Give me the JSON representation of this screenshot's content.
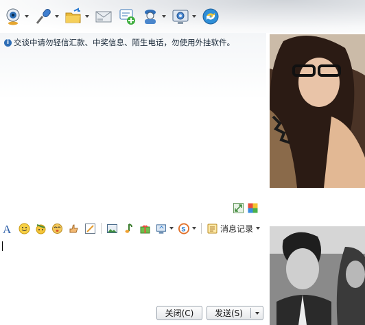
{
  "toolbar": {
    "items": [
      {
        "name": "video-call",
        "icon": "webcam-icon",
        "has_menu": true
      },
      {
        "name": "voice-call",
        "icon": "microphone-icon",
        "has_menu": true
      },
      {
        "name": "send-file",
        "icon": "folder-icon",
        "has_menu": true
      },
      {
        "name": "email",
        "icon": "mail-icon",
        "has_menu": false
      },
      {
        "name": "create-discussion",
        "icon": "add-chat-icon",
        "has_menu": false
      },
      {
        "name": "remote-assist",
        "icon": "user-badge-icon",
        "has_menu": true
      },
      {
        "name": "app",
        "icon": "settings-screen-icon",
        "has_menu": true
      },
      {
        "name": "app-share",
        "icon": "share-arrows-icon",
        "has_menu": false
      }
    ]
  },
  "notice": {
    "text": "交谈中请勿轻信汇款、中奖信息、陌生电话，勿使用外挂软件。"
  },
  "format_bar": {
    "history_label": "消息记录"
  },
  "buttons": {
    "close": "关闭(C)",
    "send": "发送(S)"
  },
  "colors": {
    "accent_blue": "#2d6db5",
    "button_border": "#9aa3ad"
  }
}
